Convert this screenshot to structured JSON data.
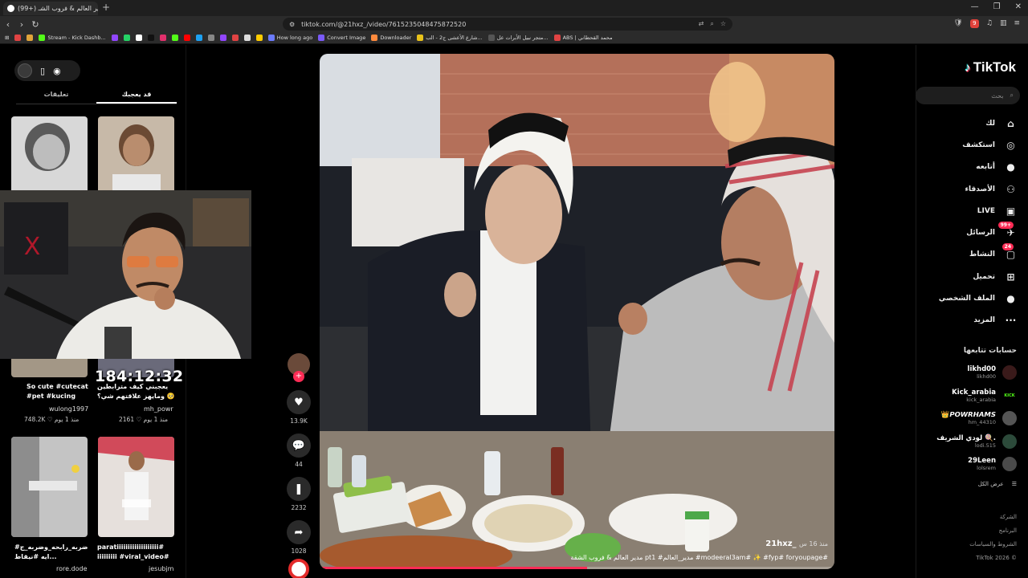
{
  "browser": {
    "tab_title": "(99+) مدير العالم & فروب الشـ...",
    "url": "tiktok.com/@21hxz_/video/7615235048475872520",
    "ext_badge": "9",
    "bookmarks": [
      {
        "label": "",
        "color": "#e04343"
      },
      {
        "label": "",
        "color": "#e0a43a"
      },
      {
        "label": "Stream - Kick Dashb...",
        "color": "#53fc18"
      },
      {
        "label": "",
        "color": "#9146ff"
      },
      {
        "label": "",
        "color": "#25d366"
      },
      {
        "label": "",
        "color": "#ffffff"
      },
      {
        "label": "",
        "color": "#111111"
      },
      {
        "label": "",
        "color": "#e1306c"
      },
      {
        "label": "",
        "color": "#53fc18"
      },
      {
        "label": "",
        "color": "#ff0000"
      },
      {
        "label": "",
        "color": "#1da1f2"
      },
      {
        "label": "",
        "color": "#888888"
      },
      {
        "label": "",
        "color": "#9146ff"
      },
      {
        "label": "",
        "color": "#e04343"
      },
      {
        "label": "",
        "color": "#dddddd"
      },
      {
        "label": "",
        "color": "#ffcc00"
      },
      {
        "label": "How long ago",
        "color": "#6b7bff"
      },
      {
        "label": "Convert Image",
        "color": "#7a5af8"
      },
      {
        "label": "Downloader",
        "color": "#ff8a3d"
      },
      {
        "label": "شارع الأعشى ج2 - الب...",
        "color": "#e8c21a"
      },
      {
        "label": "متجر نبيل الأبرات عل...",
        "color": "#555555"
      },
      {
        "label": "ABS | محمد القحطاني",
        "color": "#e04343"
      }
    ]
  },
  "sidebar": {
    "logo_text": "TikTok",
    "search_placeholder": "بحث",
    "nav": [
      {
        "label": "لك",
        "icon": "home-icon",
        "glyph": "⌂"
      },
      {
        "label": "استكشف",
        "icon": "compass-icon",
        "glyph": "◎"
      },
      {
        "label": "أتابعه",
        "icon": "avatar-icon",
        "glyph": "●"
      },
      {
        "label": "الأصدقاء",
        "icon": "friends-icon",
        "glyph": "⚇"
      },
      {
        "label": "LIVE",
        "icon": "live-icon",
        "glyph": "▣"
      },
      {
        "label": "الرسائل",
        "icon": "messages-icon",
        "glyph": "✈",
        "badge": "99+"
      },
      {
        "label": "النشاط",
        "icon": "activity-icon",
        "glyph": "▢",
        "badge": "24"
      },
      {
        "label": "تحميل",
        "icon": "upload-icon",
        "glyph": "⊞"
      },
      {
        "label": "الملف الشخصي",
        "icon": "profile-icon",
        "glyph": "●"
      },
      {
        "label": "المزيد",
        "icon": "more-icon",
        "glyph": "···"
      }
    ],
    "following_title": "حسابات تتابعها",
    "following": [
      {
        "name": "likhd00",
        "handle": "likhd00",
        "avatar_color": "#3a1a1a"
      },
      {
        "name": "Kick_arabia",
        "handle": "kick_arabia",
        "avatar_color": "#000000",
        "avatar_text": "KICK"
      },
      {
        "name": "👑𝙋𝙊𝙒𝙍𝙃𝘼𝙈𝙎",
        "handle": "hm_44310",
        "avatar_color": "#555555"
      },
      {
        "name": "لودي الشريف 🍭.",
        "handle": "lodi.515",
        "avatar_color": "#2c4a3a"
      },
      {
        "name": "29Leen",
        "handle": "lolsrem",
        "avatar_color": "#4a4a4a"
      }
    ],
    "see_all": "عرض الكل",
    "footer": [
      "الشركة",
      "البرنامج",
      "الشروط والسياسات",
      "TikTok 2026 ©"
    ]
  },
  "video": {
    "author": "21hxz_",
    "date": "منذ 16 س",
    "description": "مدير العالم & فروب الشقة pt1 #مدير_العالم #modeeral3am# ✨ #fyp# foryoupage#",
    "progress": 0.52
  },
  "actions": {
    "likes": "13.9K",
    "comments": "44",
    "saves": "2232",
    "shares": "1028"
  },
  "left": {
    "tabs": [
      "تعليقات",
      "قد يعجبك"
    ],
    "active_tab": 1,
    "timer": "184:12:32",
    "grid": [
      {
        "caption": "So cute #cutecat",
        "caption2": "#pet #kucing",
        "user": "wulong1997",
        "meta": "748.2K ♡  منذ 1 يوم",
        "color": "#cfcfcf"
      },
      {
        "caption": "يعجبني كيف مترابطين",
        "caption2": "ومايهز علاقتهم شي؟ 🥺",
        "user": "mh_powr",
        "meta": "2161 ♡  منذ 1 يوم",
        "color": "#b9b2a8"
      },
      {
        "caption": "#ضربه_رابحه_وضربه_ج",
        "caption2": "ايه #نيقاط...",
        "user": "rore.dode",
        "meta": "",
        "color": "#bdbdbd"
      },
      {
        "caption": "paratiiiiiiiiiiiiiiiiiii#",
        "caption2": "iiiiiiiii #viral_video#",
        "user": "jesubjm",
        "meta": "",
        "color": "#c9a9a9"
      }
    ]
  }
}
